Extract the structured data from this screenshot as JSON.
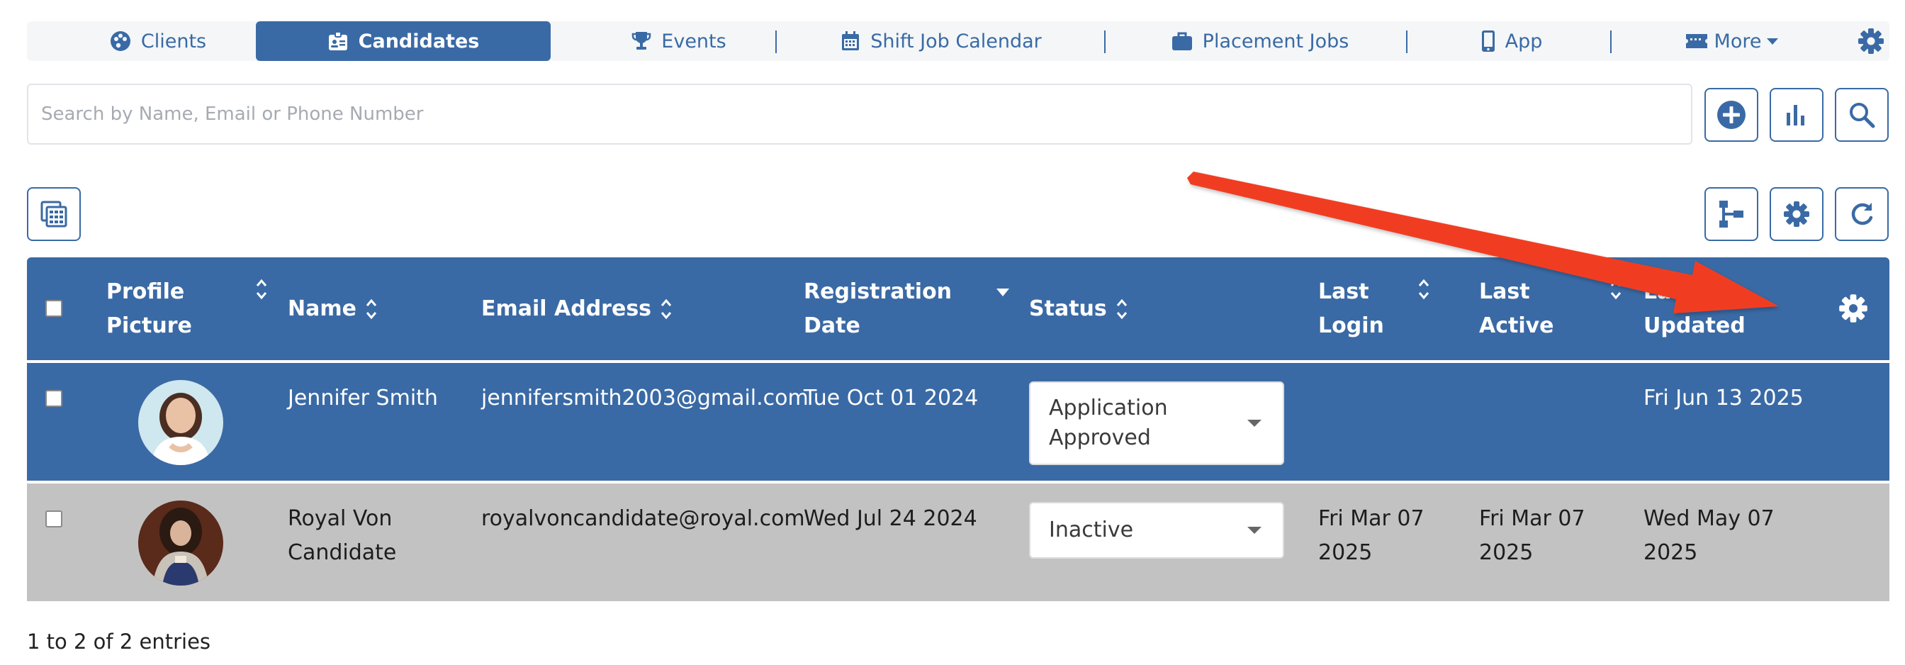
{
  "nav": {
    "items": [
      {
        "label": "Clients",
        "icon": "palette-icon"
      },
      {
        "label": "Candidates",
        "icon": "id-badge-icon"
      },
      {
        "label": "Events",
        "icon": "trophy-icon"
      },
      {
        "label": "Shift Job Calendar",
        "icon": "calendar-icon"
      },
      {
        "label": "Placement Jobs",
        "icon": "briefcase-icon"
      },
      {
        "label": "App",
        "icon": "mobile-icon"
      },
      {
        "label": "More",
        "icon": "ticket-icon"
      }
    ],
    "active": "Candidates",
    "settings_icon": "gear-icon"
  },
  "search": {
    "placeholder": "Search by Name, Email or Phone Number",
    "value": ""
  },
  "toolbar": {
    "add_icon": "plus-circle-icon",
    "chart_icon": "bar-chart-icon",
    "search_icon": "search-icon",
    "export_icon": "table-export-icon",
    "columns_icon": "hierarchy-icon",
    "settings_icon": "gear-icon",
    "refresh_icon": "refresh-icon"
  },
  "table": {
    "headers": [
      {
        "line1": "Profile",
        "line2": "Picture"
      },
      {
        "line1": "Name",
        "line2": ""
      },
      {
        "line1": "Email Address",
        "line2": ""
      },
      {
        "line1": "Registration",
        "line2": "Date"
      },
      {
        "line1": "Status",
        "line2": ""
      },
      {
        "line1": "Last",
        "line2": "Login"
      },
      {
        "line1": "Last",
        "line2": "Active"
      },
      {
        "line1": "Last",
        "line2": "Updated"
      }
    ],
    "header_settings_icon": "gear-icon",
    "rows": [
      {
        "name_line1": "Jennifer Smith",
        "name_line2": "",
        "email": "jennifersmith2003@gmail.com",
        "registration": "Tue Oct 01 2024",
        "status_line1": "Application",
        "status_line2": "Approved",
        "last_login_1": "",
        "last_login_2": "",
        "last_active_1": "",
        "last_active_2": "",
        "last_updated_1": "Fri Jun 13 2025",
        "last_updated_2": ""
      },
      {
        "name_line1": "Royal Von",
        "name_line2": "Candidate",
        "email": "royalvoncandidate@royal.com",
        "registration": "Wed Jul 24 2024",
        "status_line1": "Inactive",
        "status_line2": "",
        "last_login_1": "Fri Mar 07",
        "last_login_2": "2025",
        "last_active_1": "Fri Mar 07",
        "last_active_2": "2025",
        "last_updated_1": "Wed May 07",
        "last_updated_2": "2025"
      }
    ]
  },
  "footer": {
    "entries": "1 to 2 of 2 entries"
  },
  "colors": {
    "primary": "#3a6aa5",
    "row_alt": "#c2c2c2",
    "annotation_arrow": "#f03c24"
  }
}
